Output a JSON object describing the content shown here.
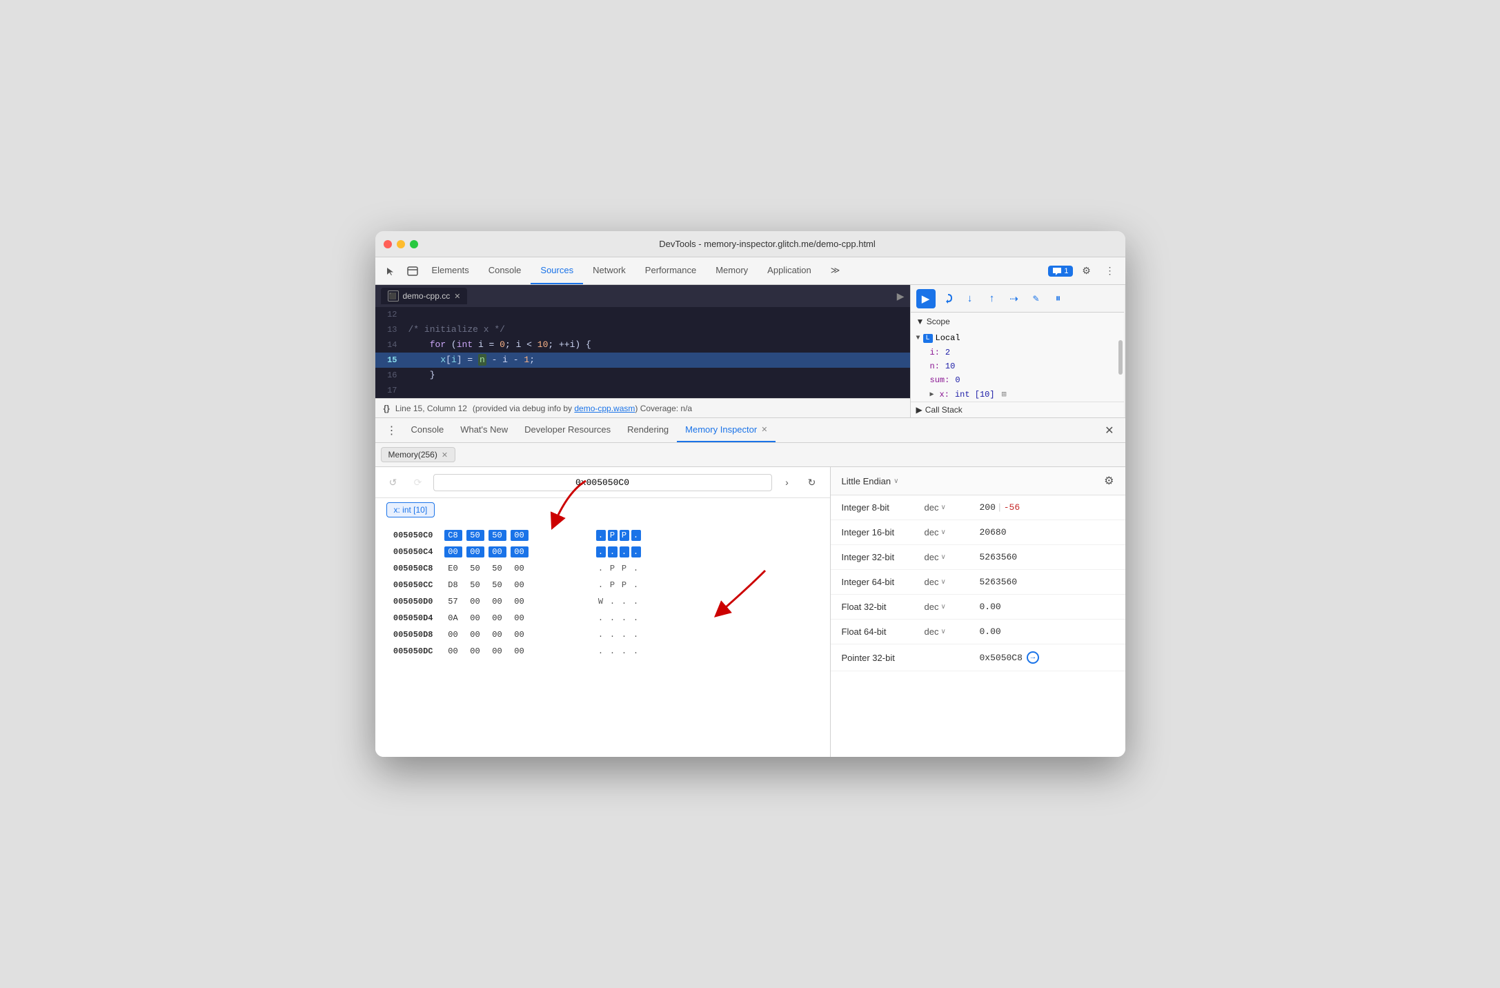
{
  "window": {
    "title": "DevTools - memory-inspector.glitch.me/demo-cpp.html"
  },
  "toolbar": {
    "tabs": [
      "Elements",
      "Console",
      "Sources",
      "Network",
      "Performance",
      "Memory",
      "Application"
    ],
    "active_tab": "Sources",
    "more_icon": "≫",
    "badge_label": "1",
    "settings_icon": "⚙",
    "menu_icon": "⋮"
  },
  "source": {
    "tab_label": "demo-cpp.cc",
    "lines": [
      {
        "num": "12",
        "code": "",
        "type": "normal"
      },
      {
        "num": "13",
        "code": "    /* initialize x */",
        "type": "comment"
      },
      {
        "num": "14",
        "code": "    for (int i = 0; i < 10; ++i) {",
        "type": "code"
      },
      {
        "num": "15",
        "code": "      x[i] = n - i - 1;",
        "type": "active"
      },
      {
        "num": "16",
        "code": "    }",
        "type": "normal"
      },
      {
        "num": "17",
        "code": "",
        "type": "normal"
      }
    ],
    "status_line": "Line 15, Column 12",
    "status_info": "(provided via debug info by",
    "status_link": "demo-cpp.wasm",
    "status_coverage": ") Coverage: n/a"
  },
  "scope": {
    "header": "Scope",
    "local_section": "Local",
    "vars": [
      {
        "name": "i:",
        "value": "2"
      },
      {
        "name": "n:",
        "value": "10"
      },
      {
        "name": "sum:",
        "value": "0"
      },
      {
        "name": "x:",
        "value": "int [10]",
        "has_memory": true
      }
    ],
    "call_stack_header": "Call Stack"
  },
  "debug_toolbar": {
    "buttons": [
      "▶",
      "↺",
      "↓",
      "↑",
      "⇢",
      "✎",
      "⏸"
    ]
  },
  "bottom_tabs": {
    "items": [
      "Console",
      "What's New",
      "Developer Resources",
      "Rendering",
      "Memory Inspector"
    ],
    "active": "Memory Inspector",
    "closeable": "Memory Inspector"
  },
  "memory_sub_tab": {
    "label": "Memory(256)"
  },
  "hex": {
    "nav_back": "↺",
    "nav_forward": "⟳",
    "address": "0x005050C0",
    "rows": [
      {
        "addr": "005050C0",
        "bytes": [
          "C8",
          "50",
          "50",
          "00"
        ],
        "chars": [
          ".",
          "P",
          "P",
          "."
        ],
        "bytes_hl": [
          true,
          false,
          false,
          false
        ],
        "chars_hl": [
          true,
          true,
          true,
          true
        ]
      },
      {
        "addr": "005050C4",
        "bytes": [
          "00",
          "00",
          "00",
          "00"
        ],
        "chars": [
          ".",
          ".",
          ".",
          "."
        ],
        "bytes_hl": [
          true,
          true,
          true,
          true
        ],
        "chars_hl": [
          true,
          true,
          true,
          true
        ]
      },
      {
        "addr": "005050C8",
        "bytes": [
          "E0",
          "50",
          "50",
          "00"
        ],
        "chars": [
          ".",
          "P",
          "P",
          "."
        ],
        "bytes_hl": [
          false,
          false,
          false,
          false
        ],
        "chars_hl": [
          false,
          false,
          false,
          false
        ]
      },
      {
        "addr": "005050CC",
        "bytes": [
          "D8",
          "50",
          "50",
          "00"
        ],
        "chars": [
          ".",
          "P",
          "P",
          "."
        ],
        "bytes_hl": [
          false,
          false,
          false,
          false
        ],
        "chars_hl": [
          false,
          false,
          false,
          false
        ]
      },
      {
        "addr": "005050D0",
        "bytes": [
          "57",
          "00",
          "00",
          "00"
        ],
        "chars": [
          "W",
          ".",
          ".",
          "."
        ],
        "bytes_hl": [
          false,
          false,
          false,
          false
        ],
        "chars_hl": [
          false,
          false,
          false,
          false
        ]
      },
      {
        "addr": "005050D4",
        "bytes": [
          "0A",
          "00",
          "00",
          "00"
        ],
        "chars": [
          ".",
          ".",
          ".",
          "."
        ],
        "bytes_hl": [
          false,
          false,
          false,
          false
        ],
        "chars_hl": [
          false,
          false,
          false,
          false
        ]
      },
      {
        "addr": "005050D8",
        "bytes": [
          "00",
          "00",
          "00",
          "00"
        ],
        "chars": [
          ".",
          ".",
          ".",
          "."
        ],
        "bytes_hl": [
          false,
          false,
          false,
          false
        ],
        "chars_hl": [
          false,
          false,
          false,
          false
        ]
      },
      {
        "addr": "005050DC",
        "bytes": [
          "00",
          "00",
          "00",
          "00"
        ],
        "chars": [
          ".",
          ".",
          ".",
          "."
        ],
        "bytes_hl": [
          false,
          false,
          false,
          false
        ],
        "chars_hl": [
          false,
          false,
          false,
          false
        ]
      }
    ]
  },
  "data_inspector": {
    "endian_label": "Little Endian",
    "rows": [
      {
        "type": "Integer 8-bit",
        "format": "dec",
        "value": "200",
        "value2": "-56"
      },
      {
        "type": "Integer 16-bit",
        "format": "dec",
        "value": "20680",
        "value2": null
      },
      {
        "type": "Integer 32-bit",
        "format": "dec",
        "value": "5263560",
        "value2": null
      },
      {
        "type": "Integer 64-bit",
        "format": "dec",
        "value": "5263560",
        "value2": null
      },
      {
        "type": "Float 32-bit",
        "format": "dec",
        "value": "0.00",
        "value2": null
      },
      {
        "type": "Float 64-bit",
        "format": "dec",
        "value": "0.00",
        "value2": null
      },
      {
        "type": "Pointer 32-bit",
        "format": null,
        "value": "0x5050C8",
        "is_pointer": true
      }
    ]
  },
  "memory_tag": {
    "label": "x: int [10]"
  }
}
